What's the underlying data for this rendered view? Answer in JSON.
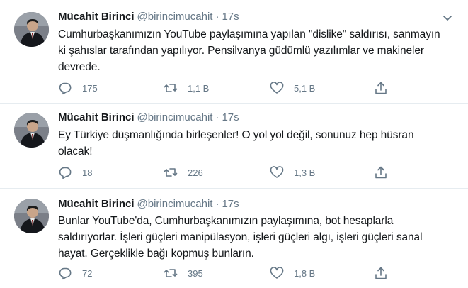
{
  "tweets": [
    {
      "name": "Mücahit Birinci",
      "handle": "@birincimucahit",
      "dot": "·",
      "time": "17s",
      "text": "Cumhurbaşkanımızın YouTube paylaşımına yapılan \"dislike\" saldırısı, sanmayın ki şahıslar tarafından yapılıyor. Pensilvanya güdümlü yazılımlar ve makineler devrede.",
      "replies": "175",
      "retweets": "1,1 B",
      "likes": "5,1 B"
    },
    {
      "name": "Mücahit Birinci",
      "handle": "@birincimucahit",
      "dot": "·",
      "time": "17s",
      "text": "Ey Türkiye düşmanlığında birleşenler! O yol yol değil, sonunuz hep hüsran olacak!",
      "replies": "18",
      "retweets": "226",
      "likes": "1,3 B"
    },
    {
      "name": "Mücahit Birinci",
      "handle": "@birincimucahit",
      "dot": "·",
      "time": "17s",
      "text": "Bunlar YouTube'da, Cumhurbaşkanımızın paylaşımına, bot hesaplarla saldırıyorlar. İşleri güçleri manipülasyon, işleri güçleri algı, işleri güçleri sanal hayat. Gerçeklikle bağı kopmuş bunların.",
      "replies": "72",
      "retweets": "395",
      "likes": "1,8 B"
    }
  ],
  "icons": {
    "reply": "reply-icon",
    "retweet": "retweet-icon",
    "like": "like-icon",
    "share": "share-icon",
    "more": "chevron-down-icon"
  },
  "colors": {
    "text": "#14171a",
    "muted": "#657786",
    "divider": "#e6ecf0"
  }
}
